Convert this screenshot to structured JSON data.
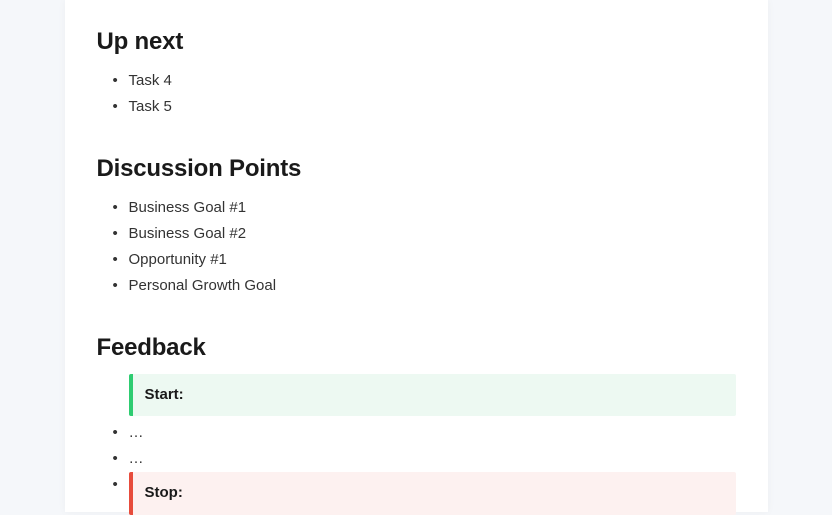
{
  "sections": {
    "up_next": {
      "heading": "Up next",
      "items": [
        "Task 4",
        "Task 5"
      ]
    },
    "discussion": {
      "heading": "Discussion Points",
      "items": [
        "Business Goal #1",
        "Business Goal #2",
        "Opportunity #1",
        "Personal Growth Goal"
      ]
    },
    "feedback": {
      "heading": "Feedback",
      "start_label": "Start:",
      "stop_label": "Stop:",
      "ellipsis": "…",
      "blank": ""
    }
  }
}
